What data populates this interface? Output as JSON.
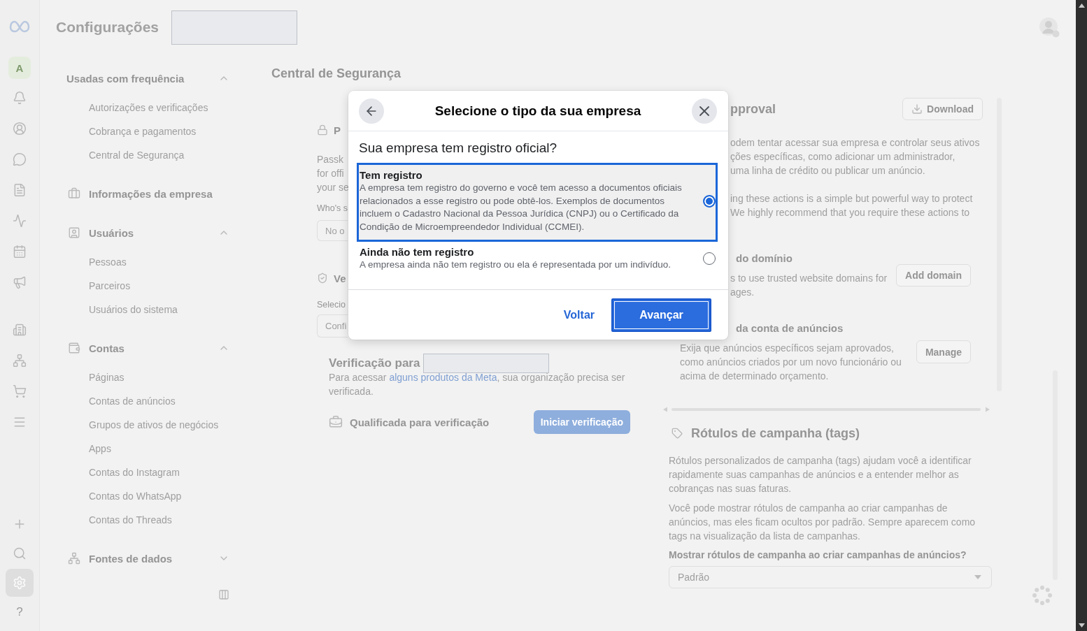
{
  "rail": {
    "account_initial": "A",
    "items": [
      {
        "selected": false
      },
      {
        "selected": false
      },
      {
        "selected": false
      },
      {
        "selected": false
      },
      {
        "selected": false
      },
      {
        "selected": false
      },
      {
        "selected": false
      }
    ],
    "more_items": [
      {
        "selected": false
      },
      {
        "selected": false
      },
      {
        "selected": false
      },
      {
        "selected": false
      }
    ],
    "bottom_items": [
      {
        "selected": false
      },
      {
        "selected": false
      },
      {
        "selected": true
      }
    ],
    "help_glyph": "?"
  },
  "header": {
    "title": "Configurações"
  },
  "sidebar": {
    "sections": [
      {
        "kind": "heading",
        "label": "Usadas com frequência",
        "expanded": true,
        "items": [
          "Autorizações e verificações",
          "Cobrança e pagamentos",
          "Central de Segurança"
        ]
      },
      {
        "kind": "link",
        "label": "Informações da empresa"
      },
      {
        "kind": "group",
        "label": "Usuários",
        "expanded": true,
        "items": [
          "Pessoas",
          "Parceiros",
          "Usuários do sistema"
        ]
      },
      {
        "kind": "group",
        "label": "Contas",
        "expanded": true,
        "items": [
          "Páginas",
          "Contas de anúncios",
          "Grupos de ativos de negócios",
          "Apps",
          "Contas do Instagram",
          "Contas do WhatsApp",
          "Contas do Threads"
        ]
      },
      {
        "kind": "group",
        "label": "Fontes de dados",
        "expanded": false
      }
    ]
  },
  "content": {
    "title": "Central de Segurança",
    "passkeys": {
      "title": "P",
      "lines": [
        "Passk",
        "for offi",
        "your se"
      ],
      "field_label": "Who's s",
      "field_value": "No o"
    },
    "confirmation": {
      "title": "Ve",
      "field_label": "Selecio",
      "field_value": "Confi"
    },
    "business_verification": {
      "title": "Verificação para",
      "text_before": "Para acessar ",
      "link": "alguns produtos da Meta",
      "text_after": ", sua organização precisa ser verificada.",
      "status": "Qualificada para verificação",
      "button": "Iniciar verificação"
    },
    "approval": {
      "title": "pproval",
      "download_button": "Download",
      "lines": [
        "odem tentar acessar sua empresa e controlar seus ativos",
        "ções específicas, como adicionar um administrador,",
        "uma linha de crédito ou publicar um anúncio."
      ],
      "lines_2": [
        "ing these actions is a simple but powerful way to protect",
        "We highly recommend that you require these actions to"
      ]
    },
    "settings": [
      {
        "kind": "partial",
        "title": "do domínio",
        "lines": [
          "s to use trusted website domains for",
          "ages."
        ],
        "button": "Add domain"
      },
      {
        "kind": "full",
        "title": "da conta de anúncios",
        "text": "Exija que anúncios específicos sejam aprovados, como anúncios criados por um novo funcionário ou acima de determinado orçamento.",
        "button": "Manage"
      }
    ],
    "campaign_tags": {
      "title": "Rótulos de campanha (tags)",
      "paragraphs": [
        "Rótulos personalizados de campanha (tags) ajudam você a identificar rapidamente suas campanhas de anúncios e a entender melhor as cobranças nas suas faturas.",
        "Você pode mostrar rótulos de campanha ao criar campanhas de anúncios, mas eles ficam ocultos por padrão. Sempre aparecem como tags na visualização da lista de campanhas."
      ],
      "question": "Mostrar rótulos de campanha ao criar campanhas de anúncios?",
      "select_value": "Padrão"
    }
  },
  "dialog": {
    "title": "Selecione o tipo da sua empresa",
    "question": "Sua empresa tem registro oficial?",
    "options": [
      {
        "title": "Tem registro",
        "description": "A empresa tem registro do governo e você tem acesso a documentos oficiais relacionados a esse registro ou pode obtê-los. Exemplos de documentos incluem o Cadastro Nacional da Pessoa Jurídica (CNPJ) ou o Certificado da Condição de Microempreendedor Individual (CCMEI).",
        "selected": true
      },
      {
        "title": "Ainda não tem registro",
        "description": "A empresa ainda não tem registro ou ela é representada por um indivíduo.",
        "selected": false
      }
    ],
    "secondary_button": "Voltar",
    "primary_button": {
      "label": "Avançar",
      "focused": true
    }
  }
}
